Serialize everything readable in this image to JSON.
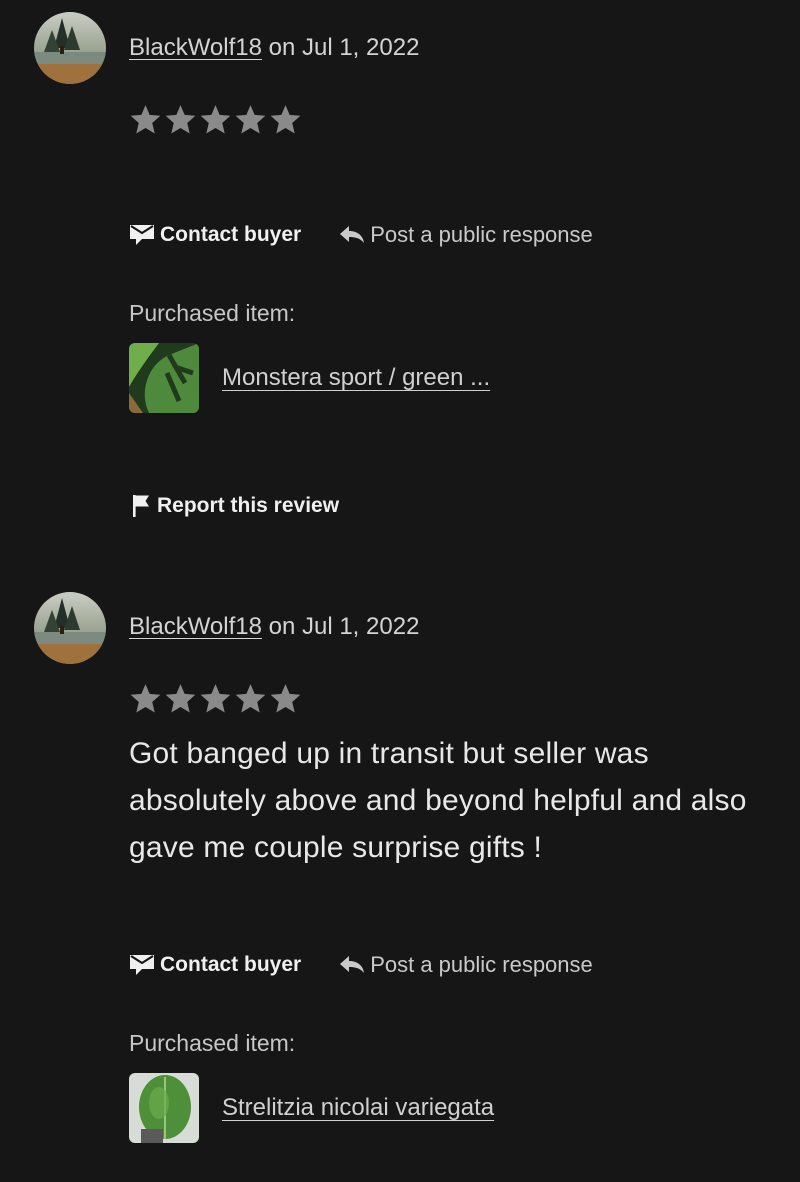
{
  "reviews": [
    {
      "username": "BlackWolf18",
      "date_text": "on Jul 1, 2022",
      "rating": 5,
      "text": "",
      "contact_label": "Contact buyer",
      "respond_label": "Post a public response",
      "purchased_label": "Purchased item:",
      "item_name": "Monstera sport / green ...",
      "report_label": "Report this review"
    },
    {
      "username": "BlackWolf18",
      "date_text": "on Jul 1, 2022",
      "rating": 5,
      "text": "Got banged up in transit but seller was absolutely above and beyond helpful and also gave me couple surprise gifts !",
      "contact_label": "Contact buyer",
      "respond_label": "Post a public response",
      "purchased_label": "Purchased item:",
      "item_name": "Strelitzia nicolai variegata"
    }
  ],
  "icons": {
    "star": "star-icon",
    "contact": "envelope-icon",
    "respond": "reply-arrow-icon",
    "report": "flag-icon"
  },
  "colors": {
    "background": "#161616",
    "star": "#8a8a8a",
    "text": "#e8e8e8"
  }
}
